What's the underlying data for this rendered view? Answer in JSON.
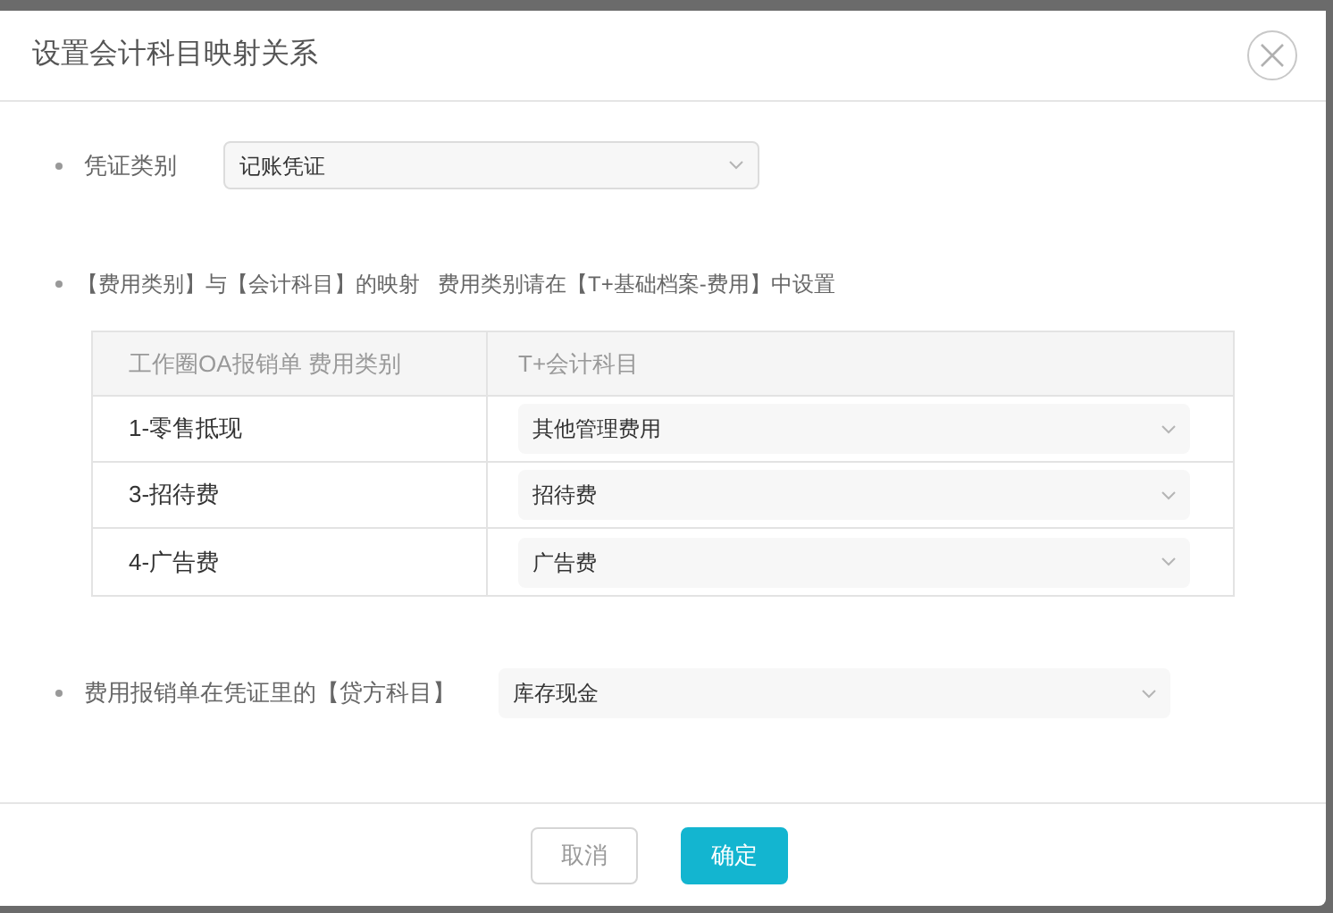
{
  "dialog": {
    "title": "设置会计科目映射关系"
  },
  "voucher_type": {
    "label": "凭证类别",
    "value": "记账凭证"
  },
  "mapping": {
    "heading": "【费用类别】与【会计科目】的映射",
    "hint": "费用类别请在【T+基础档案-费用】中设置",
    "columns": [
      "工作圈OA报销单 费用类别",
      "T+会计科目"
    ],
    "rows": [
      {
        "category": "1-零售抵现",
        "account": "其他管理费用"
      },
      {
        "category": "3-招待费",
        "account": "招待费"
      },
      {
        "category": "4-广告费",
        "account": "广告费"
      }
    ]
  },
  "credit_account": {
    "label": "费用报销单在凭证里的【贷方科目】",
    "value": "库存现金"
  },
  "buttons": [
    {
      "label": "取消",
      "kind": "secondary"
    },
    {
      "label": "确定",
      "kind": "primary"
    }
  ]
}
